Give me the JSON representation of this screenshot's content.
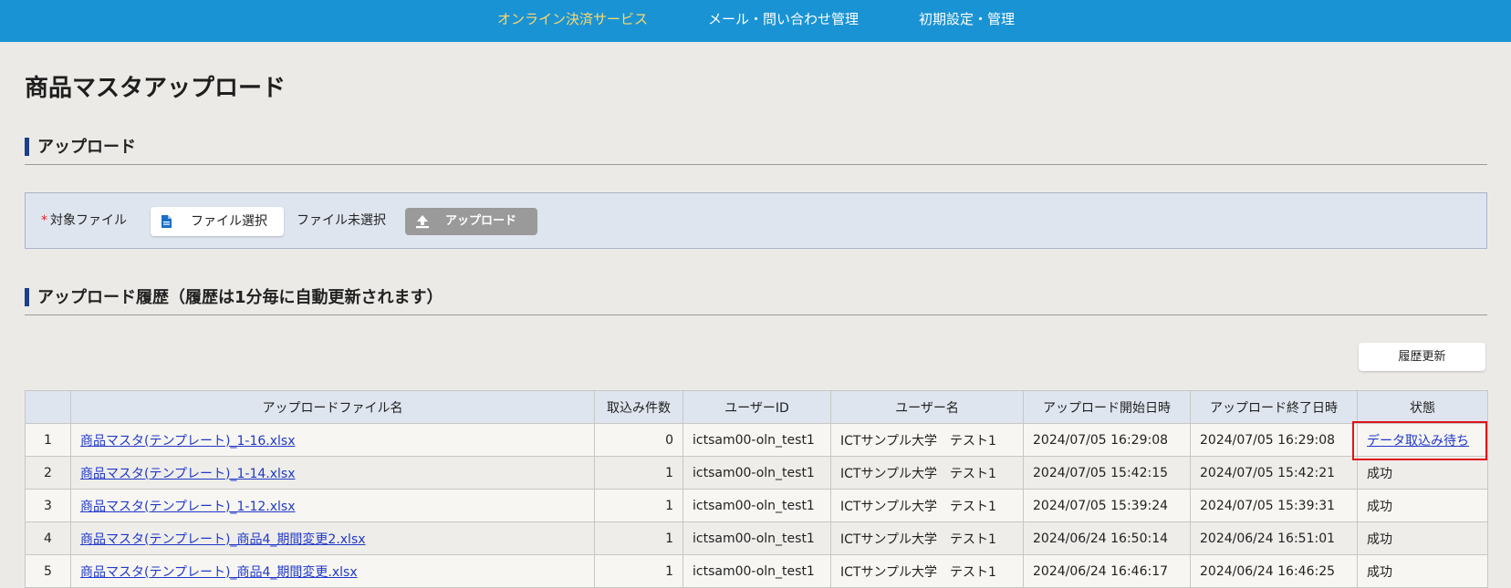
{
  "nav": {
    "items": [
      {
        "label": "オンライン決済サービス",
        "active": true
      },
      {
        "label": "メール・問い合わせ管理",
        "active": false
      },
      {
        "label": "初期設定・管理",
        "active": false
      }
    ]
  },
  "page": {
    "title": "商品マスタアップロード"
  },
  "upload_section": {
    "heading": "アップロード",
    "required_mark": "*",
    "target_label": "対象ファイル",
    "file_select_label": "ファイル選択",
    "no_file_text": "ファイル未選択",
    "upload_button_label": "アップロード"
  },
  "history_section": {
    "heading": "アップロード履歴（履歴は1分毎に自動更新されます）",
    "refresh_button_label": "履歴更新",
    "columns": [
      "",
      "アップロードファイル名",
      "取込み件数",
      "ユーザーID",
      "ユーザー名",
      "アップロード開始日時",
      "アップロード終了日時",
      "状態"
    ],
    "rows": [
      {
        "no": "1",
        "file": "商品マスタ(テンプレート)_1-16.xlsx",
        "count": "0",
        "user_id": "ictsam00-oln_test1",
        "user_name": "ICTサンプル大学　テスト1",
        "start": "2024/07/05 16:29:08",
        "end": "2024/07/05 16:29:08",
        "status": "データ取込み待ち"
      },
      {
        "no": "2",
        "file": "商品マスタ(テンプレート)_1-14.xlsx",
        "count": "1",
        "user_id": "ictsam00-oln_test1",
        "user_name": "ICTサンプル大学　テスト1",
        "start": "2024/07/05 15:42:15",
        "end": "2024/07/05 15:42:21",
        "status": "成功"
      },
      {
        "no": "3",
        "file": "商品マスタ(テンプレート)_1-12.xlsx",
        "count": "1",
        "user_id": "ictsam00-oln_test1",
        "user_name": "ICTサンプル大学　テスト1",
        "start": "2024/07/05 15:39:24",
        "end": "2024/07/05 15:39:31",
        "status": "成功"
      },
      {
        "no": "4",
        "file": "商品マスタ(テンプレート)_商品4_期間変更2.xlsx",
        "count": "1",
        "user_id": "ictsam00-oln_test1",
        "user_name": "ICTサンプル大学　テスト1",
        "start": "2024/06/24 16:50:14",
        "end": "2024/06/24 16:51:01",
        "status": "成功"
      },
      {
        "no": "5",
        "file": "商品マスタ(テンプレート)_商品4_期間変更.xlsx",
        "count": "1",
        "user_id": "ictsam00-oln_test1",
        "user_name": "ICTサンプル大学　テスト1",
        "start": "2024/06/24 16:46:17",
        "end": "2024/06/24 16:46:25",
        "status": "成功"
      }
    ]
  },
  "colors": {
    "nav_bg": "#1a93d4",
    "nav_active": "#ffd86a",
    "page_bg": "#ebeae6",
    "panel_bg": "#dfe5ef",
    "section_bar": "#1d3f8a",
    "link": "#2038c8",
    "highlight": "#e0141b"
  }
}
